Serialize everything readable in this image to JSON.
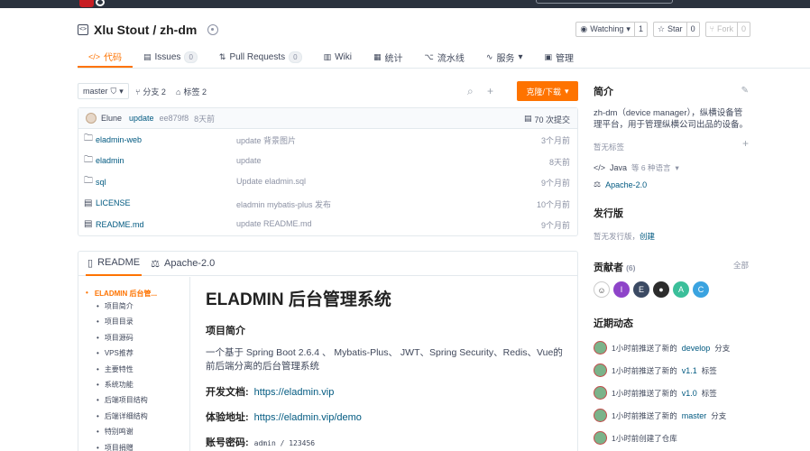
{
  "repo": {
    "title": "Xlu Stout / zh-dm",
    "watch_label": "Watching",
    "watch_count": "1",
    "star_label": "Star",
    "star_count": "0",
    "fork_label": "Fork",
    "fork_count": "0"
  },
  "tabs": [
    {
      "icon": "</>",
      "label": "代码",
      "count": ""
    },
    {
      "icon": "▤",
      "label": "Issues",
      "count": "0"
    },
    {
      "icon": "⇅",
      "label": "Pull Requests",
      "count": "0"
    },
    {
      "icon": "▥",
      "label": "Wiki",
      "count": ""
    },
    {
      "icon": "▦",
      "label": "统计",
      "count": ""
    },
    {
      "icon": "⌥",
      "label": "流水线",
      "count": ""
    },
    {
      "icon": "∿",
      "label": "服务",
      "count": ""
    },
    {
      "icon": "▣",
      "label": "管理",
      "count": ""
    }
  ],
  "branchbar": {
    "branch": "master",
    "branches": "分支 2",
    "tags": "标签 2",
    "clone_label": "克隆/下载"
  },
  "commit": {
    "author": "Elune",
    "message": "update",
    "sha": "ee879f8",
    "when": "8天前",
    "count": "70 次提交"
  },
  "files": [
    {
      "name": "eladmin-web",
      "msg": "update 背景图片",
      "time": "3个月前",
      "type": "folder"
    },
    {
      "name": "eladmin",
      "msg": "update",
      "time": "8天前",
      "type": "folder"
    },
    {
      "name": "sql",
      "msg": "Update eladmin.sql",
      "time": "9个月前",
      "type": "folder"
    },
    {
      "name": "LICENSE",
      "msg": "eladmin mybatis-plus 发布",
      "time": "10个月前",
      "type": "file"
    },
    {
      "name": "README.md",
      "msg": "update README.md",
      "time": "9个月前",
      "type": "file"
    }
  ],
  "readme": {
    "tab_readme": "README",
    "tab_license": "Apache-2.0",
    "toc_top": "ELADMIN 后台管...",
    "toc": [
      "项目简介",
      "项目目录",
      "项目源码",
      "VPS推荐",
      "主要特性",
      "系统功能",
      "后端项目结构",
      "后端详细结构",
      "特别鸣谢",
      "项目捐赠"
    ],
    "h1": "ELADMIN 后台管理系统",
    "intro_heading": "项目简介",
    "intro_text": "一个基于 Spring Boot 2.6.4 、 Mybatis-Plus、 JWT、Spring Security、Redis、Vue的前后端分离的后台管理系统",
    "doc_label": "开发文档:",
    "doc_link": "https://eladmin.vip",
    "demo_label": "体验地址:",
    "demo_link": "https://eladmin.vip/demo",
    "account_label": "账号密码:",
    "account_value": "admin / 123456"
  },
  "sidebar": {
    "intro_title": "简介",
    "description": "zh-dm（device manager），纵横设备管理平台，用于管理纵横公司出品的设备。",
    "no_tags": "暂无标签",
    "lang_java": "Java",
    "lang_more": "等 6 种语言",
    "license": "Apache-2.0",
    "release_title": "发行版",
    "no_release": "暂无发行版，",
    "create": "创建",
    "contributors_title": "贡献者",
    "contributors_count": "(6)",
    "all": "全部",
    "contributors": [
      {
        "initial": "",
        "color": "#ffffff"
      },
      {
        "initial": "I",
        "color": "#8e44c9"
      },
      {
        "initial": "E",
        "color": "#3b4a63"
      },
      {
        "initial": "",
        "color": "#2c2c2c"
      },
      {
        "initial": "A",
        "color": "#3bbf9a"
      },
      {
        "initial": "C",
        "color": "#3aa3e0"
      }
    ],
    "activity_title": "近期动态",
    "activity": [
      {
        "pre": "1小时前推送了新的",
        "ref": "develop",
        "post": "分支"
      },
      {
        "pre": "1小时前推送了新的",
        "ref": "v1.1",
        "post": "标签"
      },
      {
        "pre": "1小时前推送了新的",
        "ref": "v1.0",
        "post": "标签"
      },
      {
        "pre": "1小时前推送了新的",
        "ref": "master",
        "post": "分支"
      },
      {
        "pre": "1小时前创建了仓库",
        "ref": "",
        "post": ""
      }
    ]
  },
  "colors": {
    "accent": "#fe7300",
    "link": "#005980",
    "text": "#40485b"
  }
}
